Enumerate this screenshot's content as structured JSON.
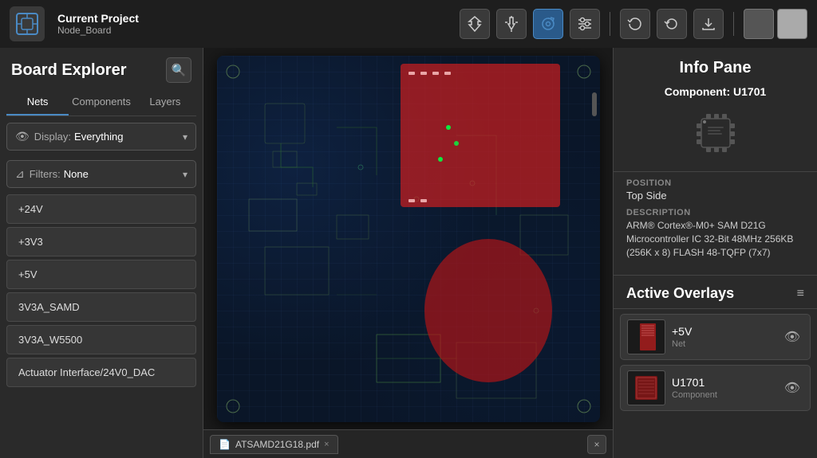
{
  "toolbar": {
    "project_label": "Current Project",
    "board_label": "Node_Board",
    "buttons": [
      {
        "name": "place-icon",
        "symbol": "⬡",
        "active": false
      },
      {
        "name": "hand-icon",
        "symbol": "✋",
        "active": false
      },
      {
        "name": "gear-spin-icon",
        "symbol": "⚙",
        "active": true
      },
      {
        "name": "sliders-icon",
        "symbol": "⊟",
        "active": false
      },
      {
        "name": "refresh-icon",
        "symbol": "↻",
        "active": false
      },
      {
        "name": "undo-icon",
        "symbol": "↩",
        "active": false
      },
      {
        "name": "export-icon",
        "symbol": "⎋",
        "active": false
      }
    ]
  },
  "left_panel": {
    "title": "Board Explorer",
    "tabs": [
      {
        "label": "Nets",
        "active": true
      },
      {
        "label": "Components",
        "active": false
      },
      {
        "label": "Layers",
        "active": false
      }
    ],
    "display": {
      "label": "Display:",
      "value": "Everything"
    },
    "filters": {
      "label": "Filters:",
      "value": "None"
    },
    "nets": [
      {
        "label": "+24V"
      },
      {
        "label": "+3V3"
      },
      {
        "label": "+5V"
      },
      {
        "label": "3V3A_SAMD"
      },
      {
        "label": "3V3A_W5500"
      },
      {
        "label": "Actuator Interface/24V0_DAC"
      }
    ]
  },
  "info_pane": {
    "title": "Info Pane",
    "component_label": "Component:",
    "component_id": "U1701",
    "position_label": "Position",
    "position_value": "Top Side",
    "description_label": "Description",
    "description_value": "ARM® Cortex®-M0+ SAM D21G Microcontroller IC 32-Bit 48MHz 256KB (256K x 8) FLASH 48-TQFP (7x7)"
  },
  "active_overlays": {
    "title": "Active Overlays",
    "menu_symbol": "≡",
    "items": [
      {
        "name": "+5V",
        "type": "Net"
      },
      {
        "name": "U1701",
        "type": "Component"
      }
    ]
  },
  "bottom_tab": {
    "label": "ATSAMD21G18.pdf",
    "close_x": "×"
  }
}
